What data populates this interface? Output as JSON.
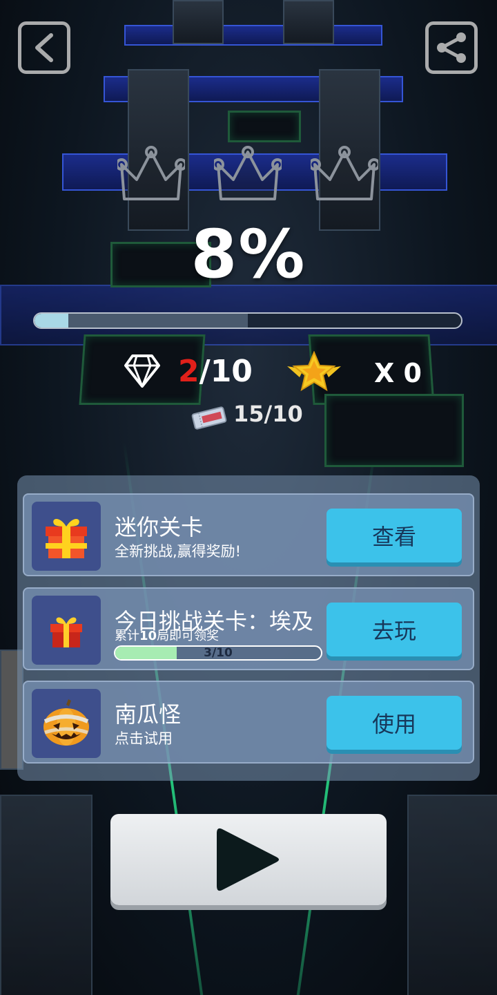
{
  "header": {
    "back_icon": "back-arrow-icon",
    "share_icon": "share-icon"
  },
  "crowns": {
    "count": 3,
    "earned": 0
  },
  "level": {
    "percent_text": "8%",
    "progress": 0.08,
    "checkpoint": 0.5
  },
  "stats": {
    "gems_current": "2",
    "gems_total": "/10",
    "stars_text": "X 0",
    "tickets_text": "15/10"
  },
  "rows": [
    {
      "title": "迷你关卡",
      "subtitle": "全新挑战,赢得奖励!",
      "button": "查看",
      "icon": "gift-box-icon"
    },
    {
      "title": "今日挑战关卡：埃及",
      "subtitle_prefix": "累计",
      "subtitle_bold": "10",
      "subtitle_suffix": "局即可领奖",
      "progress_text": "3/10",
      "progress": 0.3,
      "button": "去玩",
      "icon": "gift-box-small-icon"
    },
    {
      "title": "南瓜怪",
      "subtitle": "点击试用",
      "button": "使用",
      "icon": "pumpkin-icon"
    }
  ],
  "play": {
    "icon": "play-icon"
  },
  "colors": {
    "accent": "#3cc2ea",
    "gem_current": "#e0201a",
    "progress_fill": "#a9d8e6",
    "mini_fill": "#a7ecb2"
  }
}
